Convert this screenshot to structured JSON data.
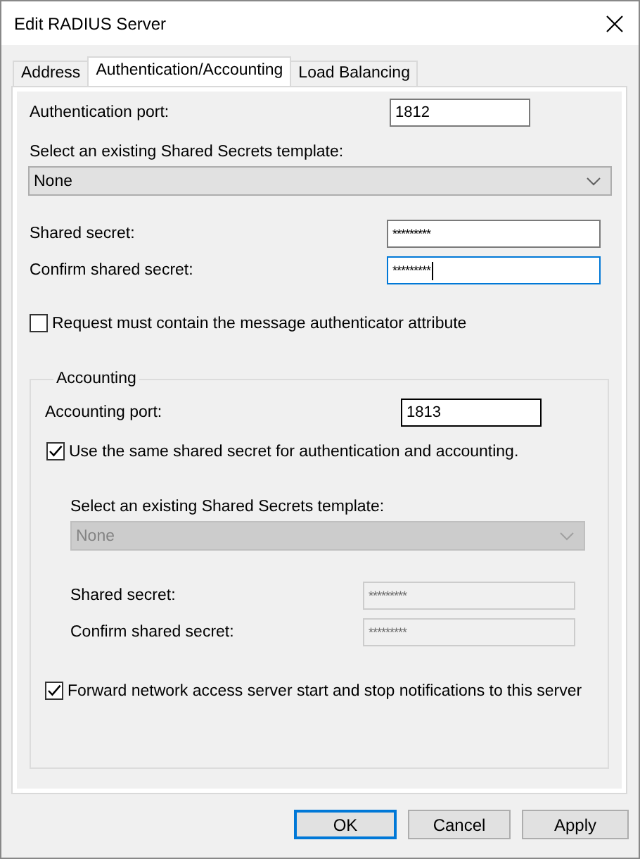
{
  "window": {
    "title": "Edit RADIUS Server"
  },
  "tabs": [
    {
      "label": "Address",
      "selected": false
    },
    {
      "label": "Authentication/Accounting",
      "selected": true
    },
    {
      "label": "Load Balancing",
      "selected": false
    }
  ],
  "authentication": {
    "port": {
      "label": "Authentication port:",
      "value": "1812"
    },
    "template": {
      "label": "Select an existing Shared Secrets template:",
      "value": "None",
      "disabled": false
    },
    "shared_secret": {
      "label": "Shared secret:",
      "value": "*********",
      "focused": false,
      "disabled": false
    },
    "confirm_shared_secret": {
      "label": "Confirm shared secret:",
      "value": "*********",
      "focused": true,
      "disabled": false
    },
    "require_authenticator": {
      "label": "Request must contain the message authenticator attribute",
      "checked": false
    }
  },
  "accounting": {
    "title": "Accounting",
    "port": {
      "label": "Accounting port:",
      "value": "1813"
    },
    "use_same_secret": {
      "label": "Use the same shared secret for authentication and accounting.",
      "checked": true
    },
    "template": {
      "label": "Select an existing Shared Secrets template:",
      "value": "None",
      "disabled": true
    },
    "shared_secret": {
      "label": "Shared secret:",
      "value": "*********",
      "focused": false,
      "disabled": true
    },
    "confirm_shared_secret": {
      "label": "Confirm shared secret:",
      "value": "*********",
      "focused": false,
      "disabled": true
    },
    "forward_notifications": {
      "label": "Forward network access server start and stop notifications to this server",
      "checked": true
    }
  },
  "buttons": [
    {
      "label": "OK",
      "default": true
    },
    {
      "label": "Cancel",
      "default": false
    },
    {
      "label": "Apply",
      "default": false
    }
  ]
}
